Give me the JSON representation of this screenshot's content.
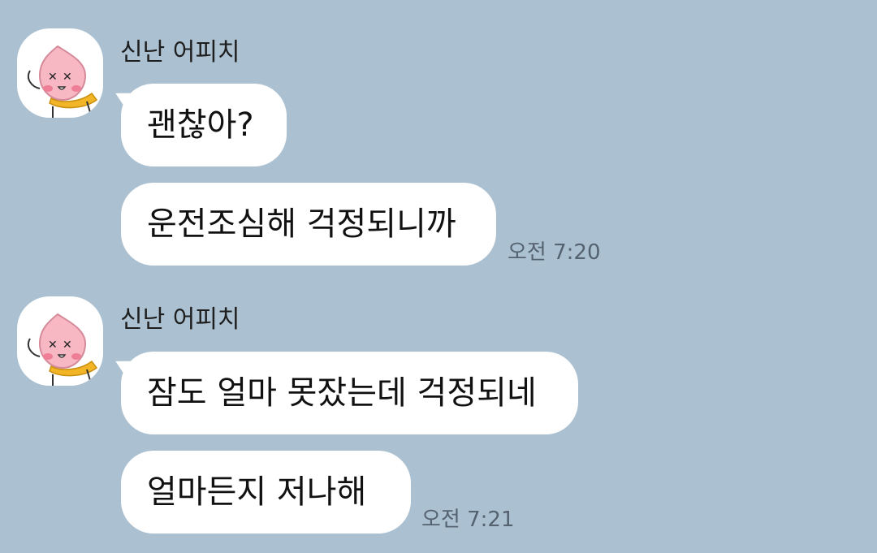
{
  "chat": {
    "groups": [
      {
        "sender": "신난 어피치",
        "messages": [
          "괜찮아?",
          "운전조심해 걱정되니까"
        ],
        "time": "오전 7:20"
      },
      {
        "sender": "신난 어피치",
        "messages": [
          "잠도 얼마 못잤는데 걱정되네",
          "얼마든지 저나해"
        ],
        "time": "오전 7:21"
      }
    ]
  },
  "icons": {
    "avatar": "apeach-character-icon"
  },
  "colors": {
    "background": "#abc1d1",
    "bubble": "#ffffff",
    "timestamp": "#556270",
    "avatar_face": "#f7b8c4",
    "scarf": "#f2b526"
  }
}
